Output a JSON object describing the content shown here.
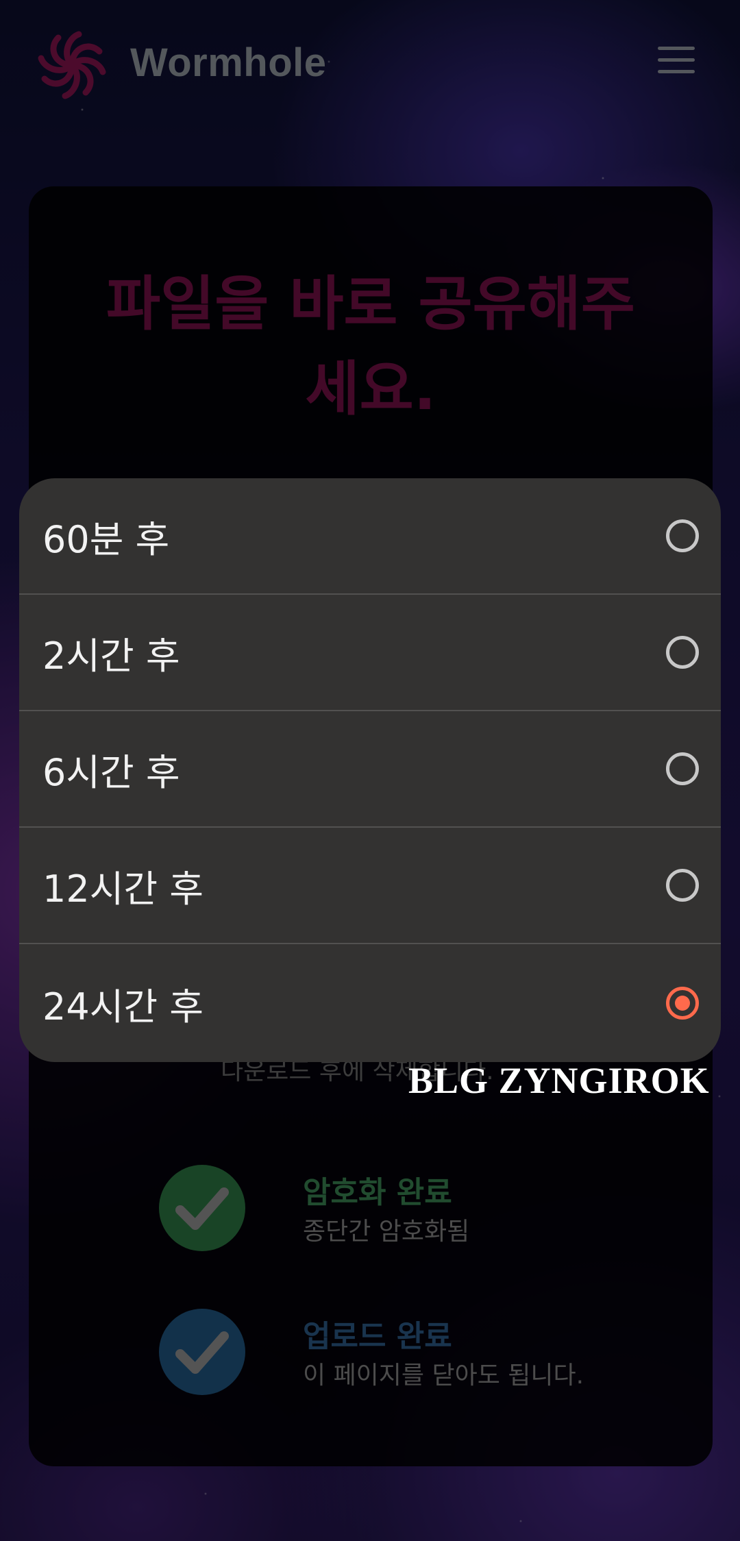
{
  "app": {
    "name": "Wormhole",
    "logo_icon": "wormhole-swirl-icon",
    "menu_icon": "hamburger-menu-icon"
  },
  "card": {
    "headline": "파일을 바로 공유해주 세요.",
    "partial_text": "다운로드 후에 삭제합니다.",
    "statuses": [
      {
        "title": "암호화 완료",
        "subtitle": "종단간 암호화됨",
        "icon": "check-icon",
        "color": "#2f7d45",
        "title_color": "#3c8a56"
      },
      {
        "title": "업로드 완료",
        "subtitle": "이 페이지를 닫아도 됩니다.",
        "icon": "check-icon",
        "color": "#215a87",
        "title_color": "#2f5f8f"
      }
    ]
  },
  "expiry_dialog": {
    "options": [
      {
        "label": "60분 후",
        "selected": false
      },
      {
        "label": "2시간 후",
        "selected": false
      },
      {
        "label": "6시간 후",
        "selected": false
      },
      {
        "label": "12시간 후",
        "selected": false
      },
      {
        "label": "24시간 후",
        "selected": true
      }
    ],
    "accent": "#ff6a4c"
  },
  "watermark": "BLG ZYNGIROK"
}
